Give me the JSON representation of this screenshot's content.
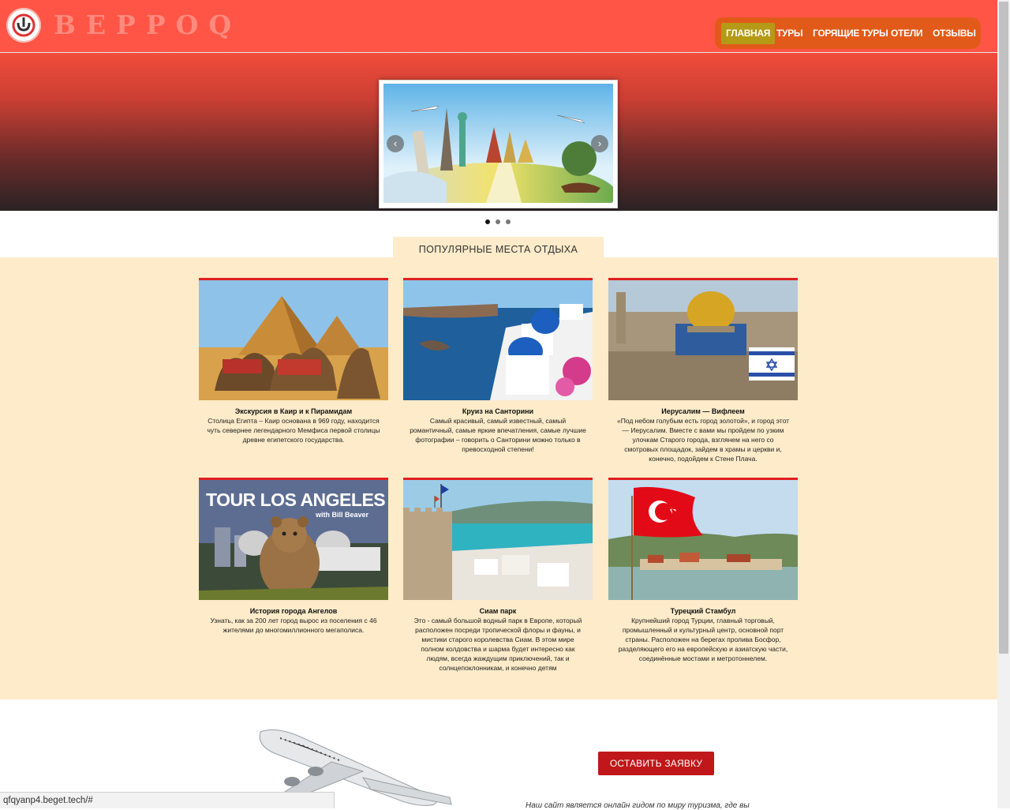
{
  "header": {
    "logo_text": "BEPPOQ",
    "nav": [
      "ГЛАВНАЯ",
      "ТУРЫ",
      "ГОРЯЩИЕ ТУРЫ",
      "ОТЕЛИ",
      "ОТЗЫВЫ"
    ],
    "active_nav": "ГЛАВНАЯ"
  },
  "slider": {
    "prev_icon": "chevron-left-icon",
    "next_icon": "chevron-right-icon",
    "dots": 3,
    "active_dot": 1
  },
  "popular": {
    "heading": "ПОПУЛЯРНЫЕ МЕСТА ОТДЫХА",
    "cards": [
      {
        "title": "Экскурсия в Каир и к Пирамидам",
        "text": "Столица Египта – Каир основана в 969 году, находится чуть севернее легендарного Мемфиса первой столицы древне египетского государства."
      },
      {
        "title": "Круиз на Санторини",
        "text": "Самый красивый, самый известный, самый романтичный, самые яркие впечатления, самые лучшие фотографии – говорить о Санторини можно только в превосходной степени!"
      },
      {
        "title": "Иерусалим — Вифлеем",
        "text": "«Под небом голубым есть город золотой», и город этот — Иерусалим. Вместе с вами мы пройдем по узким улочкам Старого города, взглянем на него со смотровых площадок, зайдем в храмы и церкви и, конечно, подойдем к Стене Плача."
      },
      {
        "title": "История города Ангелов",
        "text": "Узнать, как за 200 лет город вырос из поселения с 46 жителями до многомиллионного мегаполиса.",
        "image_caption": "TOUR LOS ANGELES",
        "image_subcaption": "with Bill Beaver"
      },
      {
        "title": "Сиам парк",
        "text": "Это - самый большой водный парк в Европе, который расположен посреди тропической флоры и фауны, и мистики старого королевства Сиам. В этом мире полном колдовства и шарма будет интересно как людям, всегда жаждущим приключений, так и солнцепоклонникам, и конечно детям"
      },
      {
        "title": "Турецкий Стамбул",
        "text": "Крупнейший город Турции, главный торговый, промышленный и культурный центр, основной порт страны. Расположен на берегах пролива Босфор, разделяющего его на европейскую и азиатскую части, соединённые мостами и метротоннелем."
      }
    ]
  },
  "cta": {
    "button": "ОСТАВИТЬ ЗАЯВКУ",
    "tagline": "Наш сайт является онлайн гидом по миру туризма, где вы"
  },
  "status_bar": {
    "url": "qfqyanp4.beget.tech/#"
  },
  "colors": {
    "header_bg": "#fe5546",
    "nav_bg": "#e25a19",
    "nav_active": "#b59a17",
    "section_bg": "#fdebc9",
    "card_border": "#e02020",
    "button_bg": "#c0171a"
  }
}
